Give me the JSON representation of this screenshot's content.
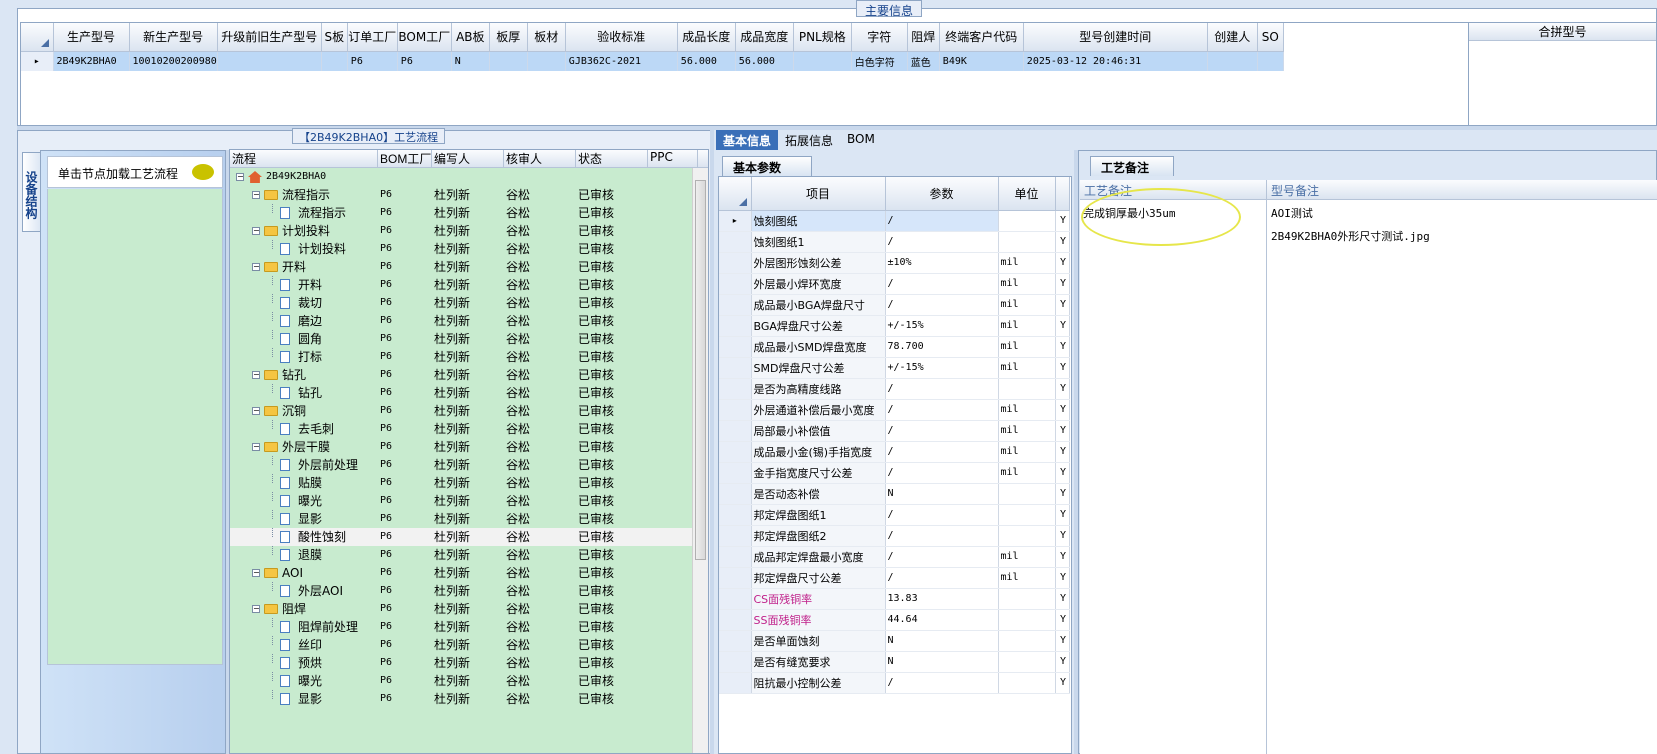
{
  "main_info": {
    "caption": "主要信息",
    "columns": [
      "生产型号",
      "新生产型号",
      "升级前旧生产型号",
      "S板",
      "订单工厂",
      "BOM工厂",
      "AB板",
      "板厚",
      "板材",
      "验收标准",
      "成品长度",
      "成品宽度",
      "PNL规格",
      "字符",
      "阻焊",
      "终端客户代码",
      "型号创建时间",
      "创建人",
      "SO"
    ],
    "row": [
      "2B49K2BHA0",
      "10010200200980",
      "",
      "",
      "P6",
      "P6",
      "N",
      "",
      "",
      "GJB362C-2021",
      "56.000",
      "56.000",
      "",
      "白色字符",
      "蓝色",
      "B49K",
      "2025-03-12 20:46:31",
      "",
      ""
    ],
    "merge_header": "合拼型号"
  },
  "process": {
    "caption": "【2B49K2BHA0】工艺流程",
    "side_tab": "设备结构",
    "node_hint": "单击节点加载工艺流程",
    "headers": [
      "流程",
      "BOM工厂",
      "编写人",
      "核审人",
      "状态",
      "PPC"
    ],
    "rows": [
      {
        "label": "2B49K2BHA0",
        "level": 0,
        "kind": "root",
        "bom": "",
        "writer": "",
        "reviewer": "",
        "state": ""
      },
      {
        "label": "流程指示",
        "level": 1,
        "kind": "folder",
        "bom": "P6",
        "writer": "杜列新",
        "reviewer": "谷松",
        "state": "已审核"
      },
      {
        "label": "流程指示",
        "level": 2,
        "kind": "doc",
        "bom": "P6",
        "writer": "杜列新",
        "reviewer": "谷松",
        "state": "已审核"
      },
      {
        "label": "计划投料",
        "level": 1,
        "kind": "folder",
        "bom": "P6",
        "writer": "杜列新",
        "reviewer": "谷松",
        "state": "已审核"
      },
      {
        "label": "计划投料",
        "level": 2,
        "kind": "doc",
        "bom": "P6",
        "writer": "杜列新",
        "reviewer": "谷松",
        "state": "已审核"
      },
      {
        "label": "开料",
        "level": 1,
        "kind": "folder",
        "bom": "P6",
        "writer": "杜列新",
        "reviewer": "谷松",
        "state": "已审核"
      },
      {
        "label": "开料",
        "level": 2,
        "kind": "doc",
        "bom": "P6",
        "writer": "杜列新",
        "reviewer": "谷松",
        "state": "已审核"
      },
      {
        "label": "裁切",
        "level": 2,
        "kind": "doc",
        "bom": "P6",
        "writer": "杜列新",
        "reviewer": "谷松",
        "state": "已审核"
      },
      {
        "label": "磨边",
        "level": 2,
        "kind": "doc",
        "bom": "P6",
        "writer": "杜列新",
        "reviewer": "谷松",
        "state": "已审核"
      },
      {
        "label": "圆角",
        "level": 2,
        "kind": "doc",
        "bom": "P6",
        "writer": "杜列新",
        "reviewer": "谷松",
        "state": "已审核"
      },
      {
        "label": "打标",
        "level": 2,
        "kind": "doc",
        "bom": "P6",
        "writer": "杜列新",
        "reviewer": "谷松",
        "state": "已审核"
      },
      {
        "label": "钻孔",
        "level": 1,
        "kind": "folder",
        "bom": "P6",
        "writer": "杜列新",
        "reviewer": "谷松",
        "state": "已审核"
      },
      {
        "label": "钻孔",
        "level": 2,
        "kind": "doc",
        "bom": "P6",
        "writer": "杜列新",
        "reviewer": "谷松",
        "state": "已审核"
      },
      {
        "label": "沉铜",
        "level": 1,
        "kind": "folder",
        "bom": "P6",
        "writer": "杜列新",
        "reviewer": "谷松",
        "state": "已审核"
      },
      {
        "label": "去毛刺",
        "level": 2,
        "kind": "doc",
        "bom": "P6",
        "writer": "杜列新",
        "reviewer": "谷松",
        "state": "已审核"
      },
      {
        "label": "外层干膜",
        "level": 1,
        "kind": "folder",
        "bom": "P6",
        "writer": "杜列新",
        "reviewer": "谷松",
        "state": "已审核"
      },
      {
        "label": "外层前处理",
        "level": 2,
        "kind": "doc",
        "bom": "P6",
        "writer": "杜列新",
        "reviewer": "谷松",
        "state": "已审核"
      },
      {
        "label": "贴膜",
        "level": 2,
        "kind": "doc",
        "bom": "P6",
        "writer": "杜列新",
        "reviewer": "谷松",
        "state": "已审核"
      },
      {
        "label": "曝光",
        "level": 2,
        "kind": "doc",
        "bom": "P6",
        "writer": "杜列新",
        "reviewer": "谷松",
        "state": "已审核"
      },
      {
        "label": "显影",
        "level": 2,
        "kind": "doc",
        "bom": "P6",
        "writer": "杜列新",
        "reviewer": "谷松",
        "state": "已审核"
      },
      {
        "label": "酸性蚀刻",
        "level": 2,
        "kind": "doc",
        "bom": "P6",
        "writer": "杜列新",
        "reviewer": "谷松",
        "state": "已审核",
        "selected": true
      },
      {
        "label": "退膜",
        "level": 2,
        "kind": "doc",
        "bom": "P6",
        "writer": "杜列新",
        "reviewer": "谷松",
        "state": "已审核"
      },
      {
        "label": "AOI",
        "level": 1,
        "kind": "folder",
        "bom": "P6",
        "writer": "杜列新",
        "reviewer": "谷松",
        "state": "已审核"
      },
      {
        "label": "外层AOI",
        "level": 2,
        "kind": "doc",
        "bom": "P6",
        "writer": "杜列新",
        "reviewer": "谷松",
        "state": "已审核"
      },
      {
        "label": "阻焊",
        "level": 1,
        "kind": "folder",
        "bom": "P6",
        "writer": "杜列新",
        "reviewer": "谷松",
        "state": "已审核"
      },
      {
        "label": "阻焊前处理",
        "level": 2,
        "kind": "doc",
        "bom": "P6",
        "writer": "杜列新",
        "reviewer": "谷松",
        "state": "已审核"
      },
      {
        "label": "丝印",
        "level": 2,
        "kind": "doc",
        "bom": "P6",
        "writer": "杜列新",
        "reviewer": "谷松",
        "state": "已审核"
      },
      {
        "label": "预烘",
        "level": 2,
        "kind": "doc",
        "bom": "P6",
        "writer": "杜列新",
        "reviewer": "谷松",
        "state": "已审核"
      },
      {
        "label": "曝光",
        "level": 2,
        "kind": "doc",
        "bom": "P6",
        "writer": "杜列新",
        "reviewer": "谷松",
        "state": "已审核"
      },
      {
        "label": "显影",
        "level": 2,
        "kind": "doc",
        "bom": "P6",
        "writer": "杜列新",
        "reviewer": "谷松",
        "state": "已审核"
      }
    ]
  },
  "info": {
    "tabs": [
      "基本信息",
      "拓展信息",
      "BOM"
    ],
    "sub_tab": "基本参数",
    "param_headers": [
      "项目",
      "参数",
      "单位"
    ],
    "params": [
      {
        "item": "蚀刻图纸",
        "value": "/",
        "unit": "",
        "flag": "Y"
      },
      {
        "item": "蚀刻图纸1",
        "value": "/",
        "unit": "",
        "flag": "Y"
      },
      {
        "item": "外层图形蚀刻公差",
        "value": "±10%",
        "unit": "mil",
        "flag": "Y"
      },
      {
        "item": "外层最小焊环宽度",
        "value": "/",
        "unit": "mil",
        "flag": "Y"
      },
      {
        "item": "成品最小BGA焊盘尺寸",
        "value": "/",
        "unit": "mil",
        "flag": "Y"
      },
      {
        "item": "BGA焊盘尺寸公差",
        "value": "+/-15%",
        "unit": "mil",
        "flag": "Y"
      },
      {
        "item": "成品最小SMD焊盘宽度",
        "value": "78.700",
        "unit": "mil",
        "flag": "Y"
      },
      {
        "item": "SMD焊盘尺寸公差",
        "value": "+/-15%",
        "unit": "mil",
        "flag": "Y"
      },
      {
        "item": "是否为高精度线路",
        "value": "/",
        "unit": "",
        "flag": "Y"
      },
      {
        "item": "外层通道补偿后最小宽度",
        "value": "/",
        "unit": "mil",
        "flag": "Y"
      },
      {
        "item": "局部最小补偿值",
        "value": "/",
        "unit": "mil",
        "flag": "Y"
      },
      {
        "item": "成品最小金(锡)手指宽度",
        "value": "/",
        "unit": "mil",
        "flag": "Y"
      },
      {
        "item": "金手指宽度尺寸公差",
        "value": "/",
        "unit": "mil",
        "flag": "Y"
      },
      {
        "item": "是否动态补偿",
        "value": "N",
        "unit": "",
        "flag": "Y"
      },
      {
        "item": "邦定焊盘图纸1",
        "value": "/",
        "unit": "",
        "flag": "Y"
      },
      {
        "item": "邦定焊盘图纸2",
        "value": "/",
        "unit": "",
        "flag": "Y"
      },
      {
        "item": "成品邦定焊盘最小宽度",
        "value": "/",
        "unit": "mil",
        "flag": "Y"
      },
      {
        "item": "邦定焊盘尺寸公差",
        "value": "/",
        "unit": "mil",
        "flag": "Y"
      },
      {
        "item": "CS面残铜率",
        "value": "13.83",
        "unit": "",
        "flag": "Y",
        "pink": true
      },
      {
        "item": "SS面残铜率",
        "value": "44.64",
        "unit": "",
        "flag": "Y",
        "pink": true
      },
      {
        "item": "是否单面蚀刻",
        "value": "N",
        "unit": "",
        "flag": "Y"
      },
      {
        "item": "是否有缝宽要求",
        "value": "N",
        "unit": "",
        "flag": "Y"
      },
      {
        "item": "阻抗最小控制公差",
        "value": "/",
        "unit": "",
        "flag": "Y"
      }
    ]
  },
  "remarks": {
    "tab": "工艺备注",
    "col1_header": "工艺备注",
    "col2_header": "型号备注",
    "process_remark": "完成铜厚最小35um",
    "model_remark_1": "AOI测试",
    "model_remark_2": "2B49K2BHA0外形尺寸测试.jpg"
  }
}
